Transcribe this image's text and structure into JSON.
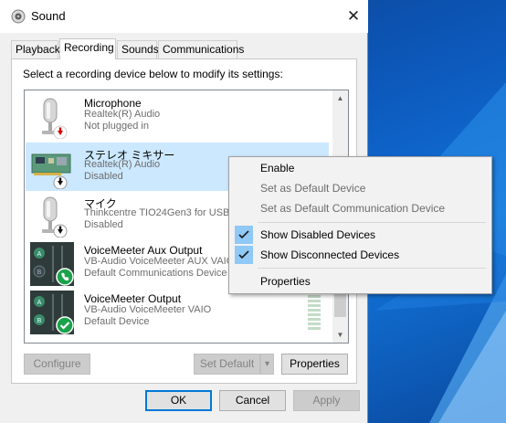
{
  "window": {
    "title": "Sound",
    "icon": "speaker-icon",
    "close": "✕"
  },
  "tabs": [
    {
      "label": "Playback",
      "active": false
    },
    {
      "label": "Recording",
      "active": true
    },
    {
      "label": "Sounds",
      "active": false
    },
    {
      "label": "Communications",
      "active": false
    }
  ],
  "instruction": "Select a recording device below to modify its settings:",
  "devices": [
    {
      "name": "Microphone",
      "driver": "Realtek(R) Audio",
      "status": "Not plugged in",
      "icon": "microphone-icon",
      "badge": "red-down-arrow-badge",
      "selected": false
    },
    {
      "name": "ステレオ ミキサー",
      "driver": "Realtek(R) Audio",
      "status": "Disabled",
      "icon": "sound-card-icon",
      "badge": "down-arrow-badge",
      "selected": true
    },
    {
      "name": "マイク",
      "driver": "Thinkcentre TIO24Gen3 for USB",
      "status": "Disabled",
      "icon": "microphone-icon",
      "badge": "down-arrow-badge",
      "selected": false
    },
    {
      "name": "VoiceMeeter Aux Output",
      "driver": "VB-Audio VoiceMeeter AUX VAIO",
      "status": "Default Communications Device",
      "icon": "voicemeeter-icon",
      "badge": "green-phone-badge",
      "selected": false
    },
    {
      "name": "VoiceMeeter Output",
      "driver": "VB-Audio VoiceMeeter VAIO",
      "status": "Default Device",
      "icon": "voicemeeter-icon",
      "badge": "green-check-badge",
      "selected": false
    }
  ],
  "panel_buttons": {
    "configure": "Configure",
    "set_default": "Set Default",
    "set_default_arrow": "▾",
    "properties": "Properties"
  },
  "dialog_buttons": {
    "ok": "OK",
    "cancel": "Cancel",
    "apply": "Apply"
  },
  "context_menu": [
    {
      "label": "Enable",
      "enabled": true,
      "checked": false
    },
    {
      "label": "Set as Default Device",
      "enabled": false,
      "checked": false
    },
    {
      "label": "Set as Default Communication Device",
      "enabled": false,
      "checked": false
    },
    {
      "label": "Show Disabled Devices",
      "enabled": true,
      "checked": true
    },
    {
      "label": "Show Disconnected Devices",
      "enabled": true,
      "checked": true
    },
    {
      "label": "Properties",
      "enabled": true,
      "checked": false
    }
  ],
  "colors": {
    "accent": "#0078d7",
    "selection": "#cce8ff",
    "menu_check": "#90c8f6",
    "status_red": "#d40000",
    "status_green": "#1aa34a"
  }
}
